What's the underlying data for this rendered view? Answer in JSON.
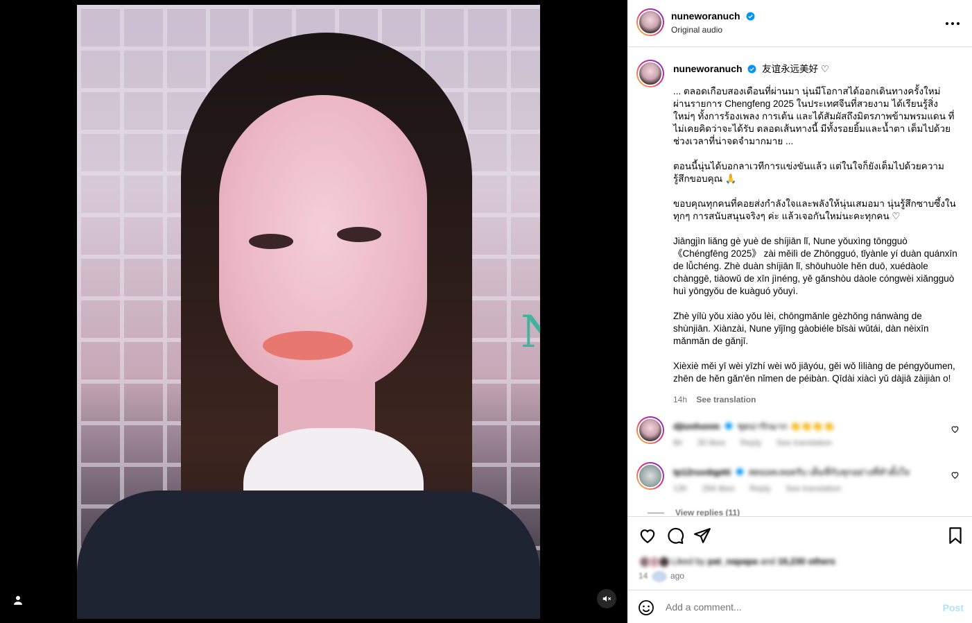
{
  "post": {
    "username": "nuneworanuch",
    "audio": "Original audio"
  },
  "caption": {
    "username": "nuneworanuch",
    "title": "友谊永远美好 ♡",
    "paragraphs": [
      "... ตลอดเกือบสองเดือนที่ผ่านมา นุ่นมีโอกาสได้ออกเดินทางครั้งใหม่ ผ่านรายการ Chengfeng 2025 ในประเทศจีนที่สวยงาม ได้เรียนรู้สิ่งใหม่ๆ ทั้งการร้องเพลง การเต้น และได้สัมผัสถึงมิตรภาพข้ามพรมแดน ที่ไม่เคยคิดว่าจะได้รับ ตลอดเส้นทางนี้ มีทั้งรอยยิ้มและน้ำตา เต็มไปด้วยช่วงเวลาที่น่าจดจำมากมาย ...",
      "ตอนนี้นุ่นได้บอกลาเวทีการแข่งขันแล้ว แต่ในใจก็ยังเต็มไปด้วยความรู้สึกขอบคุณ 🙏",
      "ขอบคุณทุกคนที่คอยส่งกำลังใจและพลังให้นุ่นเสมอมา นุ่นรู้สึกซาบซึ้งในทุกๆ การสนับสนุนจริงๆ ค่ะ แล้วเจอกันใหม่นะคะทุกคน ♡",
      "Jiāngjìn liǎng gè yuè de shíjiān lǐ, Nune yǒuxìng tōngguò《Chéngfēng 2025》 zài měilì de Zhōngguó, tǐyànle yí duàn quánxīn de lǚchéng. Zhè duàn shíjiān lǐ, shōuhuòle hěn duō, xuédàole chànggē, tiàowǔ de xīn jìnéng, yě gǎnshòu dàole cóngwèi xiǎngguò huì yōngyǒu de kuàguó yǒuyì.",
      "Zhè yílù yǒu xiào yǒu lèi, chōngmǎnle gèzhǒng nánwàng de shùnjiān. Xiànzài, Nune yǐjīng gàobiéle bǐsài wǔtái, dàn nèixīn mǎnmǎn de gǎnjī.",
      "Xièxiè měi yī wèi yīzhí wèi wǒ jiāyóu, gěi wǒ lìliàng de péngyǒumen, zhēn de hěn gǎn'ēn nǐmen de péibàn. Qīdài xiàcì yǔ dàjiā zàijiàn o!"
    ],
    "time": "14h",
    "see_translation": "See translation"
  },
  "comments": [
    {
      "username": "djtonhonm",
      "text": "ชุดน่ารักมาก 👏👏👏👏",
      "time": "8h",
      "likes": "30 likes",
      "reply": "Reply",
      "see_translation": "See translation"
    },
    {
      "username": "tp12ruvdqptti",
      "text": "สดยอดเลยครับ เต็มที่กับทุกอย่างที่ทำตั้งใจ",
      "time": "13h",
      "likes": "294 likes",
      "reply": "Reply",
      "see_translation": "See translation"
    }
  ],
  "view_replies": "View replies (11)",
  "likes_line": {
    "prefix": "Liked by",
    "user": "pat_napapa",
    "mid": "and",
    "count": "16,230 others"
  },
  "time_row": {
    "a": "14",
    "b": "ago"
  },
  "composer": {
    "placeholder": "Add a comment...",
    "post_label": "Post"
  },
  "colors": {
    "accent": "#0095f6",
    "verified": "#0095f6",
    "muted_text": "#737373",
    "border": "#dbdbdb"
  },
  "icons": [
    "more-horizontal-icon",
    "verified-badge-icon",
    "heart-icon",
    "comment-icon",
    "share-icon",
    "bookmark-icon",
    "emoji-icon",
    "muted-speaker-icon",
    "person-icon"
  ]
}
